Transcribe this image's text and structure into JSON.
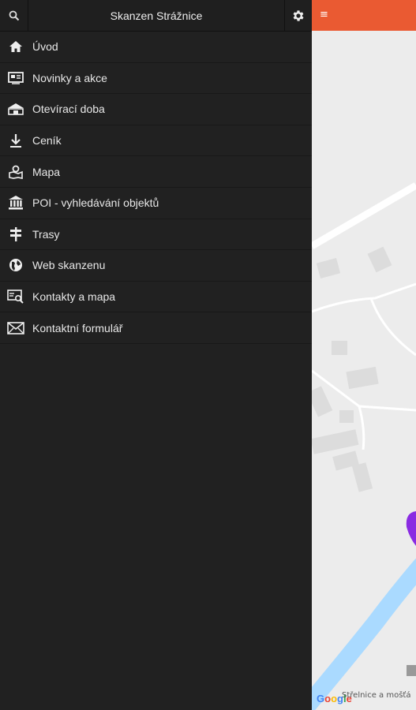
{
  "drawer": {
    "title": "Skanzen Strážnice",
    "search_icon": "search-icon",
    "settings_icon": "gear-icon",
    "items": [
      {
        "label": "Úvod",
        "icon": "home-icon"
      },
      {
        "label": "Novinky a akce",
        "icon": "news-icon"
      },
      {
        "label": "Otevírací doba",
        "icon": "building-icon"
      },
      {
        "label": "Ceník",
        "icon": "download-icon"
      },
      {
        "label": "Mapa",
        "icon": "map-icon"
      },
      {
        "label": "POI - vyhledávání objektů",
        "icon": "museum-icon"
      },
      {
        "label": "Trasy",
        "icon": "signpost-icon"
      },
      {
        "label": "Web skanzenu",
        "icon": "globe-icon"
      },
      {
        "label": "Kontakty a mapa",
        "icon": "contact-search-icon"
      },
      {
        "label": "Kontaktní formulář",
        "icon": "mail-icon"
      }
    ]
  },
  "map": {
    "attribution": "Střelnice a mošťá",
    "logo": "Google",
    "accent_color": "#ea5a32",
    "marker_color": "#8a2be2"
  }
}
